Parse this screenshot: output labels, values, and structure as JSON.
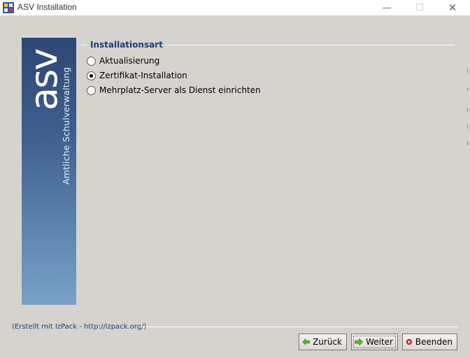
{
  "window": {
    "title": "ASV Installation",
    "controls": {
      "minimize": "—",
      "maximize": "☐",
      "close": "✕"
    }
  },
  "side_panel": {
    "logo_text": "asv",
    "caption": "Amtliche Schulverwaltung"
  },
  "group": {
    "title": "Installationsart",
    "options": [
      {
        "label": "Aktualisierung",
        "selected": false
      },
      {
        "label": "Zertifikat-Installation",
        "selected": true
      },
      {
        "label": "Mehrplatz-Server als Dienst einrichten",
        "selected": false
      }
    ]
  },
  "footer": {
    "credit": "(Erstellt mit IzPack - http://izpack.org/)",
    "buttons": {
      "back": "Zurück",
      "next": "Weiter",
      "quit": "Beenden"
    }
  },
  "colors": {
    "accent": "#1d3c7e",
    "panel_top": "#2e4672",
    "panel_bottom": "#7aa2c7",
    "background": "#d6d3ce"
  }
}
